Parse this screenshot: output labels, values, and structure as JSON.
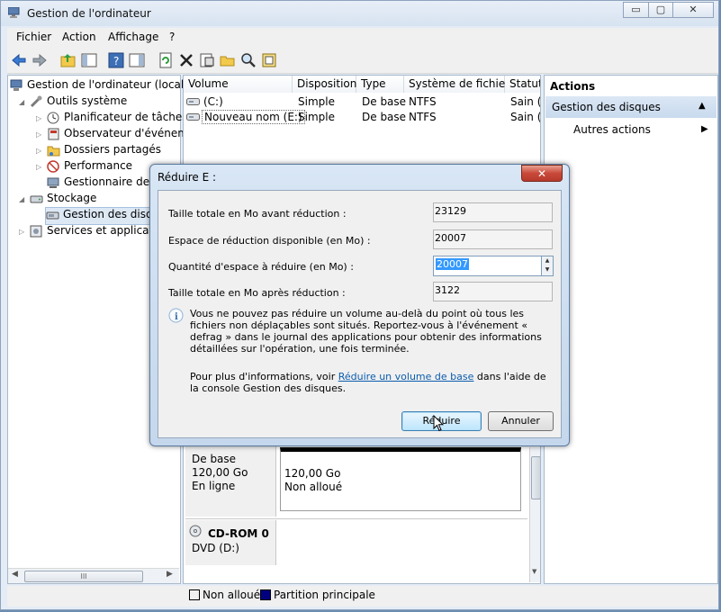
{
  "window": {
    "title": "Gestion de l'ordinateur",
    "minimize": "▭",
    "maximize": "▢",
    "close": "✕"
  },
  "menu": [
    "Fichier",
    "Action",
    "Affichage",
    "?"
  ],
  "tree": {
    "root": "Gestion de l'ordinateur (local)",
    "system_tools": "Outils système",
    "task_scheduler": "Planificateur de tâches",
    "event_viewer": "Observateur d'événeme",
    "shared_folders": "Dossiers partagés",
    "performance": "Performance",
    "device_manager": "Gestionnaire de pé",
    "storage": "Stockage",
    "disk_management": "Gestion des disque",
    "services": "Services et applicatio",
    "scroll_grip": "III"
  },
  "volumes": {
    "columns": [
      "Volume",
      "Disposition",
      "Type",
      "Système de fichiers",
      "Statut"
    ],
    "rows": [
      [
        "(C:)",
        "Simple",
        "De base",
        "NTFS",
        "Sain (S"
      ],
      [
        "Nouveau nom (E:)",
        "Simple",
        "De base",
        "NTFS",
        "Sain (R"
      ]
    ]
  },
  "disks": {
    "disk1_type": "De base",
    "disk1_size": "120,00 Go",
    "disk1_state": "En ligne",
    "unalloc_size": "120,00 Go",
    "unalloc_label": "Non alloué",
    "cdrom_name": "CD-ROM 0",
    "cdrom_drive": "DVD (D:)"
  },
  "legend": {
    "unallocated": "Non alloué",
    "primary": "Partition principale",
    "unallocated_color": "#000000",
    "primary_color": "#000080"
  },
  "actions": {
    "title": "Actions",
    "section": "Gestion des disques",
    "more": "Autres actions"
  },
  "dialog": {
    "title": "Réduire E :",
    "close": "✕",
    "total_before_label": "Taille totale en Mo avant réduction :",
    "total_before_value": "23129",
    "available_label": "Espace de réduction disponible (en Mo) :",
    "available_value": "20007",
    "amount_label": "Quantité d'espace à réduire (en Mo) :",
    "amount_value": "20007",
    "total_after_label": "Taille totale en Mo après réduction :",
    "total_after_value": "3122",
    "info": "Vous ne pouvez pas réduire un volume au-delà du point où tous les fichiers non déplaçables sont situés. Reportez-vous à l'événement « defrag » dans le journal des applications pour obtenir des informations détaillées sur l'opération, une fois terminée.",
    "more_prefix": "Pour plus d'informations, voir ",
    "more_link": "Réduire un volume de base",
    "more_suffix": " dans l'aide de la console Gestion des disques.",
    "reduce_button": "Réduire",
    "cancel_button": "Annuler"
  }
}
